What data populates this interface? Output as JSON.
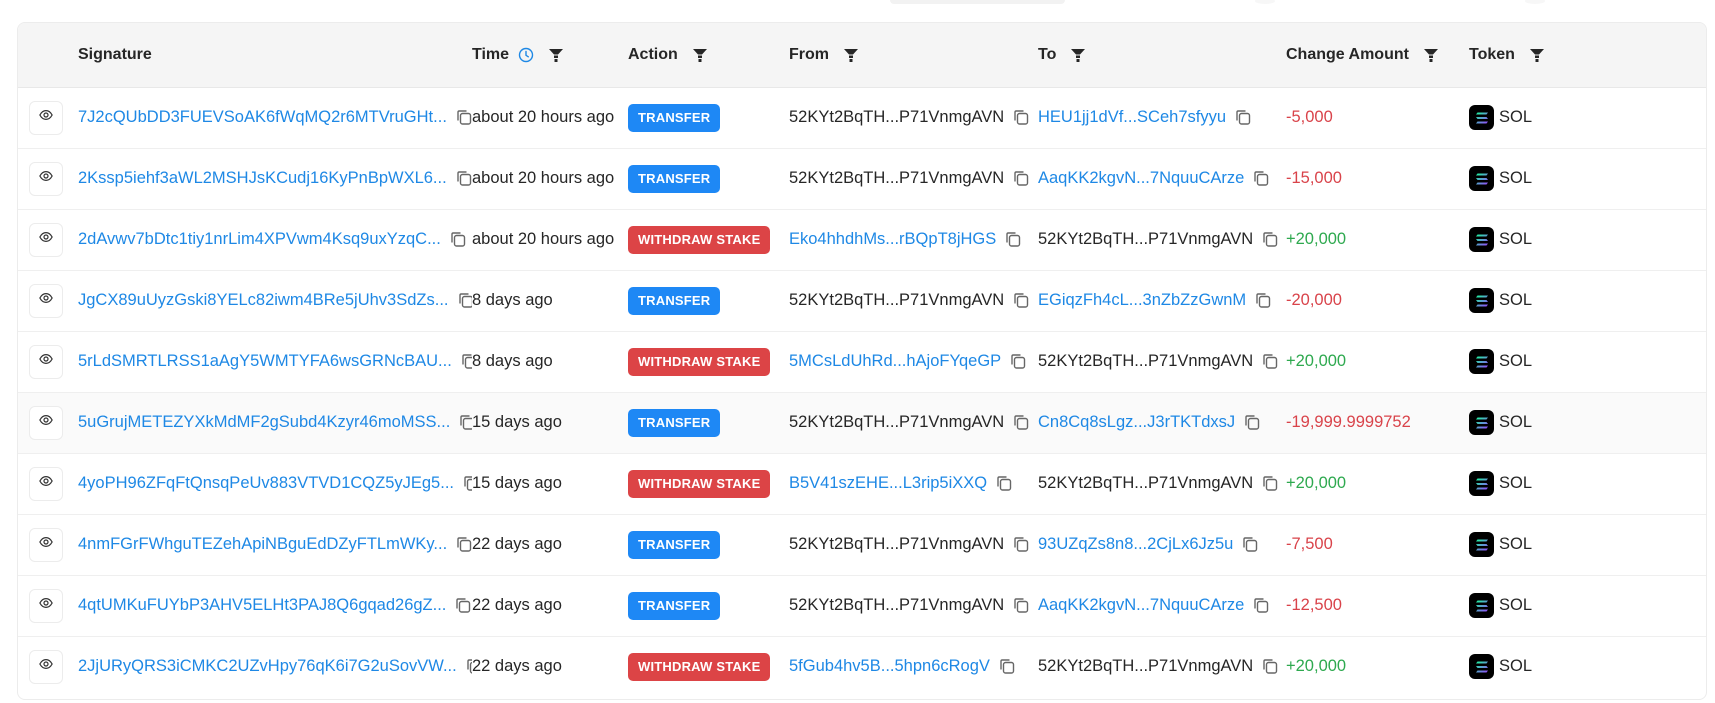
{
  "colors": {
    "link": "#1e88e5",
    "transfer_badge": "#1e88f5",
    "withdraw_badge": "#dc4446",
    "negative": "#d9434a",
    "positive": "#2ea94f"
  },
  "table": {
    "columns": {
      "signature": "Signature",
      "time": "Time",
      "action": "Action",
      "from": "From",
      "to": "To",
      "change_amount": "Change Amount",
      "token": "Token"
    },
    "header_icons": {
      "time_sort": "clock-icon",
      "filter": "filter-icon"
    },
    "rows": [
      {
        "signature": "7J2cQUbDD3FUEVSoAK6fWqMQ2r6MTVruGHt...",
        "time": "about 20 hours ago",
        "action": "TRANSFER",
        "action_type": "transfer",
        "from": "52KYt2BqTH...P71VnmgAVN",
        "from_is_link": false,
        "to": "HEU1jj1dVf...SCeh7sfyyu",
        "to_is_link": true,
        "amount": "-5,000",
        "amount_sign": "neg",
        "token": "SOL"
      },
      {
        "signature": "2Kssp5iehf3aWL2MSHJsKCudj16KyPnBpWXL6...",
        "time": "about 20 hours ago",
        "action": "TRANSFER",
        "action_type": "transfer",
        "from": "52KYt2BqTH...P71VnmgAVN",
        "from_is_link": false,
        "to": "AaqKK2kgvN...7NquuCArze",
        "to_is_link": true,
        "amount": "-15,000",
        "amount_sign": "neg",
        "token": "SOL"
      },
      {
        "signature": "2dAvwv7bDtc1tiy1nrLim4XPVwm4Ksq9uxYzqC...",
        "time": "about 20 hours ago",
        "action": "WITHDRAW STAKE",
        "action_type": "withdraw",
        "from": "Eko4hhdhMs...rBQpT8jHGS",
        "from_is_link": true,
        "to": "52KYt2BqTH...P71VnmgAVN",
        "to_is_link": false,
        "amount": "+20,000",
        "amount_sign": "pos",
        "token": "SOL"
      },
      {
        "signature": "JgCX89uUyzGski8YELc82iwm4BRe5jUhv3SdZs...",
        "time": "8 days ago",
        "action": "TRANSFER",
        "action_type": "transfer",
        "from": "52KYt2BqTH...P71VnmgAVN",
        "from_is_link": false,
        "to": "EGiqzFh4cL...3nZbZzGwnM",
        "to_is_link": true,
        "amount": "-20,000",
        "amount_sign": "neg",
        "token": "SOL"
      },
      {
        "signature": "5rLdSMRTLRSS1aAgY5WMTYFA6wsGRNcBAU...",
        "time": "8 days ago",
        "action": "WITHDRAW STAKE",
        "action_type": "withdraw",
        "from": "5MCsLdUhRd...hAjoFYqeGP",
        "from_is_link": true,
        "to": "52KYt2BqTH...P71VnmgAVN",
        "to_is_link": false,
        "amount": "+20,000",
        "amount_sign": "pos",
        "token": "SOL"
      },
      {
        "signature": "5uGrujMETEZYXkMdMF2gSubd4Kzyr46moMSS...",
        "time": "15 days ago",
        "action": "TRANSFER",
        "action_type": "transfer",
        "from": "52KYt2BqTH...P71VnmgAVN",
        "from_is_link": false,
        "to": "Cn8Cq8sLgz...J3rTKTdxsJ",
        "to_is_link": true,
        "amount": "-19,999.9999752",
        "amount_sign": "neg",
        "token": "SOL",
        "hovered": true
      },
      {
        "signature": "4yoPH96ZFqFtQnsqPeUv883VTVD1CQZ5yJEg5...",
        "time": "15 days ago",
        "action": "WITHDRAW STAKE",
        "action_type": "withdraw",
        "from": "B5V41szEHE...L3rip5iXXQ",
        "from_is_link": true,
        "to": "52KYt2BqTH...P71VnmgAVN",
        "to_is_link": false,
        "amount": "+20,000",
        "amount_sign": "pos",
        "token": "SOL"
      },
      {
        "signature": "4nmFGrFWhguTEZehApiNBguEdDZyFTLmWKy...",
        "time": "22 days ago",
        "action": "TRANSFER",
        "action_type": "transfer",
        "from": "52KYt2BqTH...P71VnmgAVN",
        "from_is_link": false,
        "to": "93UZqZs8n8...2CjLx6Jz5u",
        "to_is_link": true,
        "amount": "-7,500",
        "amount_sign": "neg",
        "token": "SOL"
      },
      {
        "signature": "4qtUMKuFUYbP3AHV5ELHt3PAJ8Q6gqad26gZ...",
        "time": "22 days ago",
        "action": "TRANSFER",
        "action_type": "transfer",
        "from": "52KYt2BqTH...P71VnmgAVN",
        "from_is_link": false,
        "to": "AaqKK2kgvN...7NquuCArze",
        "to_is_link": true,
        "amount": "-12,500",
        "amount_sign": "neg",
        "token": "SOL"
      },
      {
        "signature": "2JjURyQRS3iCMKC2UZvHpy76qK6i7G2uSovVW...",
        "time": "22 days ago",
        "action": "WITHDRAW STAKE",
        "action_type": "withdraw",
        "from": "5fGub4hv5B...5hpn6cRogV",
        "from_is_link": true,
        "to": "52KYt2BqTH...P71VnmgAVN",
        "to_is_link": false,
        "amount": "+20,000",
        "amount_sign": "pos",
        "token": "SOL"
      }
    ]
  }
}
